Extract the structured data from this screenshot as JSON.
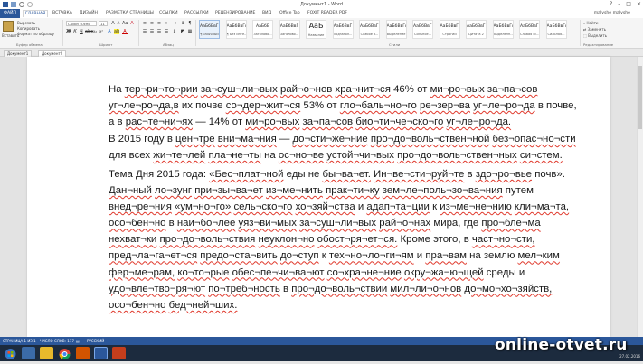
{
  "window": {
    "title": "Документ1 - Word",
    "controls": [
      "?",
      "–",
      "□",
      "×"
    ]
  },
  "tabs": {
    "file": "ФАЙЛ",
    "items": [
      "ГЛАВНАЯ",
      "ВСТАВКА",
      "ДИЗАЙН",
      "РАЗМЕТКА СТРАНИЦЫ",
      "ССЫЛКИ",
      "РАССЫЛКИ",
      "РЕЦЕНЗИРОВАНИЕ",
      "ВИД",
      "Office Tab",
      "FOXIT READER PDF"
    ],
    "active": "ГЛАВНАЯ",
    "user": "malyshe malyshe"
  },
  "ribbon": {
    "clipboard": {
      "paste": "Вставить",
      "cut": "Вырезать",
      "copy": "Копировать",
      "format_painter": "Формат по образцу",
      "group_label": "Буфер обмена"
    },
    "font": {
      "family": "Calibri (Осно",
      "size": "11",
      "group_label": "Шрифт"
    },
    "paragraph": {
      "group_label": "Абзац"
    },
    "styles": {
      "group_label": "Стили",
      "items": [
        {
          "preview": "АаБбВвГг",
          "name": "¶ Обычный",
          "selected": true
        },
        {
          "preview": "АаБбВвГг",
          "name": "¶ Без инте...",
          "selected": false
        },
        {
          "preview": "АаБбВ",
          "name": "Заголово...",
          "selected": false
        },
        {
          "preview": "АаБбВвГ",
          "name": "Заголово...",
          "selected": false
        },
        {
          "preview": "АаБ",
          "name": "Название",
          "selected": false
        },
        {
          "preview": "АаБбВвГ",
          "name": "Подзагол...",
          "selected": false
        },
        {
          "preview": "АаБбВвГг",
          "name": "Слабое в...",
          "selected": false
        },
        {
          "preview": "АаБбВвГг",
          "name": "Выделение",
          "selected": false
        },
        {
          "preview": "АаБбВвГг",
          "name": "Сильное...",
          "selected": false
        },
        {
          "preview": "АаБбВвГг",
          "name": "Строгий",
          "selected": false
        },
        {
          "preview": "АаБбВвГг",
          "name": "Цитата 2",
          "selected": false
        },
        {
          "preview": "АаБбВвГг",
          "name": "Выделенн...",
          "selected": false
        },
        {
          "preview": "АаБбВвГг",
          "name": "Слабая сс...",
          "selected": false
        },
        {
          "preview": "АаБбВвГг",
          "name": "Сильная...",
          "selected": false
        }
      ]
    },
    "editing": {
      "find": "Найти",
      "replace": "Заменить",
      "select": "Выделить",
      "group_label": "Редактирование"
    }
  },
  "doc_tabs": [
    "Документ1",
    "Документ2"
  ],
  "document": {
    "paragraphs": [
      "На тер¬ри¬то¬рии за¬суш¬ли¬вых рай¬о¬нов хра¬нит¬ся 46% от ми¬ро¬вых за¬па¬сов уг¬ле¬ро¬да,в их почве со¬дер¬жит¬ся 53% от гло¬баль¬но¬го ре¬зер¬ва уг¬ле¬ро¬да в почве, а в рас¬те¬ни¬ях — 14% от ми¬ро¬вых за¬па¬сов био¬ти¬че¬ско¬го уг¬ле¬ро¬да.",
      "В 2015 году в цен¬тре вни¬ма¬ния — до¬сти¬же¬ние про¬до¬воль¬ствен¬ной без¬опас¬но¬сти для всех жи¬те¬лей пла¬не¬ты на ос¬но¬ве устой¬чи¬вых про¬до¬воль¬ствен¬ных си¬стем.",
      "Тема Дня 2015 года: «Бес¬плат¬ной еды не бы¬ва¬ет. Ин¬ве¬сти¬руй¬те в здо¬ро¬вье почв». Дан¬ный ло¬зунг при¬зы¬ва¬ет из¬ме¬нить прак¬ти¬ку зем¬ле¬поль¬зо¬ва¬ния путем внед¬ре¬ния «ум¬но¬го» сель¬ско¬го хо¬зяй¬ства и адап¬та¬ции к из¬ме¬не¬нию кли¬ма¬та, осо¬бен¬но в наи¬бо¬лее уяз¬ви¬мых за¬суш¬ли¬вых рай¬о¬нах мира, где про¬бле¬ма нехват¬ки про¬до¬воль¬ствия неуклон¬но обост¬ря¬ет¬ся. Кроме этого, в част¬но¬сти, пред¬ла¬га¬ет¬ся предо¬ста¬вить до¬ступ к тех¬но¬ло¬ги¬ям и пра¬вам на землю мел¬ким фер¬ме¬рам, ко¬то¬рые обес¬пе¬чи¬ва¬ют со¬хра¬не¬ние окру¬жа¬ю¬щей среды и удо¬вле¬тво¬ря¬ют по¬треб¬ность в про¬до¬воль¬ствии мил¬ли¬о¬нов до¬мо¬хо¬зяйств, осо¬бен¬но бед¬ней¬ших."
    ]
  },
  "status": {
    "page": "СТРАНИЦА 1 ИЗ 1",
    "words": "ЧИСЛО СЛОВ: 117",
    "language": "РУССКИЙ"
  },
  "watermark": "online-otvet.ru",
  "clock": "27.02.2016",
  "colors": {
    "accent": "#2b579a",
    "spell_underline": "#e0392c",
    "taskbar": "#1c2b3e"
  }
}
